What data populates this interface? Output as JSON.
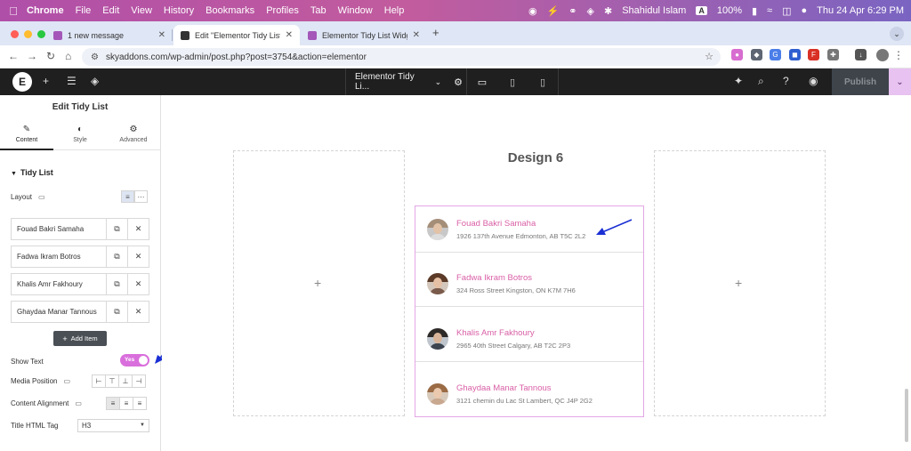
{
  "menubar": {
    "app": "Chrome",
    "items": [
      "File",
      "Edit",
      "View",
      "History",
      "Bookmarks",
      "Profiles",
      "Tab",
      "Window",
      "Help"
    ],
    "user": "Shahidul Islam",
    "input_badge": "A",
    "battery": "100%",
    "datetime": "Thu 24 Apr  6:29 PM"
  },
  "browser": {
    "tabs": [
      {
        "label": "1 new message",
        "fav_color": "#a457b9"
      },
      {
        "label": "Edit \"Elementor Tidy List Wid...",
        "fav_color": "#333333"
      },
      {
        "label": "Elementor Tidy List Widget - ...",
        "fav_color": "#a457b9"
      }
    ],
    "url": "skyaddons.com/wp-admin/post.php?post=3754&action=elementor"
  },
  "elementor": {
    "doc_title": "Elementor Tidy Li...",
    "publish_label": "Publish",
    "panel_title": "Edit Tidy List",
    "panel_tabs": [
      "Content",
      "Style",
      "Advanced"
    ],
    "section_label": "Tidy List",
    "layout_label": "Layout",
    "items": [
      "Fouad Bakri Samaha",
      "Fadwa Ikram Botros",
      "Khalis Amr Fakhoury",
      "Ghaydaa Manar Tannous"
    ],
    "add_item_label": "Add Item",
    "show_text_label": "Show Text",
    "toggle_label": "Yes",
    "media_position_label": "Media Position",
    "content_alignment_label": "Content Alignment",
    "title_tag_label": "Title HTML Tag",
    "title_tag_value": "H3"
  },
  "canvas": {
    "heading": "Design 6",
    "list": [
      {
        "name": "Fouad Bakri Samaha",
        "address": "1926 137th Avenue Edmonton, AB T5C 2L2"
      },
      {
        "name": "Fadwa Ikram Botros",
        "address": "324 Ross Street Kingston, ON K7M 7H6"
      },
      {
        "name": "Khalis Amr Fakhoury",
        "address": "2965 40th Street Calgary, AB T2C 2P3"
      },
      {
        "name": "Ghaydaa Manar Tannous",
        "address": "3121 chemin du Lac St Lambert, QC J4P 2G2"
      }
    ]
  },
  "colors": {
    "accent_pink": "#d95fa6",
    "toggle": "#d96fdc",
    "annotation_arrow": "#1a2fd4",
    "elementor_bar": "#1f1f1f"
  }
}
